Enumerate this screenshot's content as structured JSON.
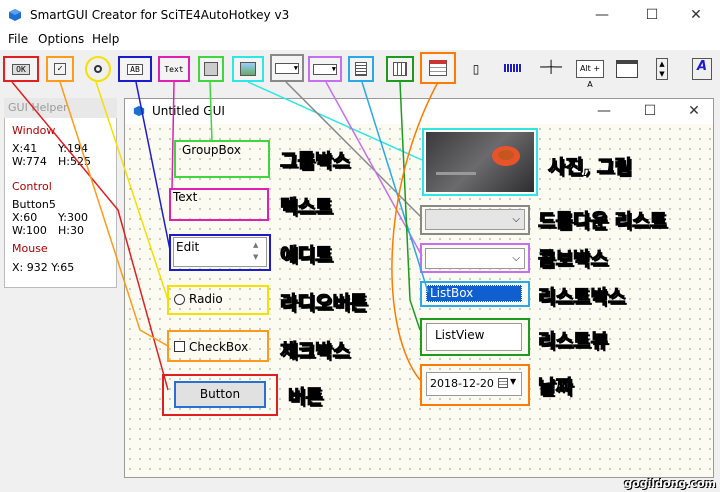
{
  "app": {
    "title": "SmartGUI Creator for SciTE4AutoHotkey v3"
  },
  "menu": [
    "File",
    "Options",
    "Help"
  ],
  "toolbar": {
    "ok": "OK",
    "checkbox": "✓",
    "edit": "AB",
    "text": "Text",
    "date_caption": "Alt + A"
  },
  "helper": {
    "title": "GUI Helper",
    "window_label": "Window",
    "window_x": "X:41",
    "window_y": "Y:194",
    "window_w": "W:774",
    "window_h": "H:525",
    "control_label": "Control",
    "control_name": "Button5",
    "control_x": "X:60",
    "control_y": "Y:300",
    "control_w": "W:100",
    "control_h": "H:30",
    "mouse_label": "Mouse",
    "mouse_xy": "X: 932  Y:65"
  },
  "gui": {
    "title": "Untitled GUI",
    "groupbox": "GroupBox",
    "text": "Text",
    "edit": "Edit",
    "radio": "Radio",
    "checkbox": "CheckBox",
    "button": "Button",
    "listbox": "ListBox",
    "listview": "ListView",
    "date": "2018-12-20"
  },
  "labels": {
    "groupbox": "그룹박스",
    "text": "텍스트",
    "edit": "에디트",
    "radio": "라디오버튼",
    "checkbox": "체크박스",
    "button": "버튼",
    "picture": "사진, 그림",
    "dropdown": "드롭다운 리스트",
    "combobox": "콤보박스",
    "listbox": "리스트박스",
    "listview": "리스트뷰",
    "date": "날짜"
  },
  "watermark": "gogildong.com",
  "colors": {
    "red": "#e02020",
    "orange": "#ff9a1a",
    "yellow": "#f5e000",
    "blue": "#1c1ccc",
    "magenta": "#e020b0",
    "green": "#3fd63f",
    "cyan": "#2ee6e6",
    "gray": "#888888",
    "violet": "#c470f0",
    "skyblue": "#2aa8e8",
    "darkgreen": "#1e9a1e",
    "darkorange": "#ff7a00"
  }
}
